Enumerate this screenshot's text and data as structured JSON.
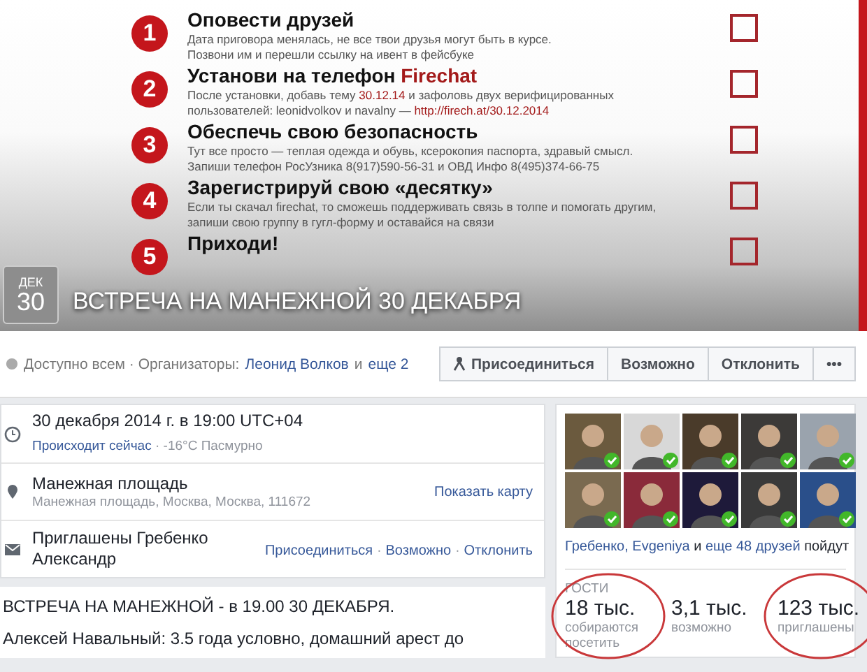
{
  "cover": {
    "checklist": [
      {
        "number": "1",
        "title": "Оповести друзей",
        "lines": [
          "Дата приговора менялась, не все твои друзья могут быть в курсе.",
          "Позвони им и перешли ссылку на ивент в фейсбуке"
        ],
        "checked": false
      },
      {
        "number": "2",
        "title": "Установи на телефон **Firechat**",
        "lines": [
          "После установки, добавь тему **30.12.14** и зафоловь двух верифицированных",
          "пользователей: leonidvolkov и navalny —  **http://firech.at/30.12.2014**"
        ],
        "checked": false
      },
      {
        "number": "3",
        "title": "Обеспечь свою безопасность",
        "lines": [
          "Тут все просто — теплая одежда и обувь, ксерокопия паспорта, здравый смысл.",
          "Запиши телефон РосУзника 8(917)590-56-31 и ОВД Инфо 8(495)374-66-75"
        ],
        "checked": false
      },
      {
        "number": "4",
        "title": "Зарегистрируй свою «десятку»",
        "lines": [
          "Если ты скачал firechat, то сможешь поддерживать связь в толпе и помогать другим,",
          "запиши свою группу в гугл-форму и оставайся на связи"
        ],
        "checked": false
      },
      {
        "number": "5",
        "title": "Приходи!",
        "checked": false
      }
    ],
    "date_badge": {
      "month": "ДЕК",
      "day": "30"
    },
    "title": "ВСТРЕЧА НА МАНЕЖНОЙ 30 ДЕКАБРЯ"
  },
  "info_bar": {
    "privacy": "Доступно всем · Организаторы:",
    "organizer": "Леонид Волков",
    "and": "и",
    "more": "еще 2",
    "buttons": [
      {
        "label": "Присоединиться",
        "kind": "join"
      },
      {
        "label": "Возможно",
        "kind": "plain"
      },
      {
        "label": "Отклонить",
        "kind": "plain"
      },
      {
        "label": "•••",
        "kind": "more"
      }
    ]
  },
  "details": [
    {
      "kind": "time",
      "title": "30 декабря 2014 г. в 19:00 UTC+04",
      "status": "Происходит сейчас",
      "sub": " · -16°C Пасмурно"
    },
    {
      "kind": "place",
      "title": "Манежная площадь",
      "sub": "Манежная площадь, Москва, Москва, 111672",
      "action": "Показать карту"
    },
    {
      "kind": "invite",
      "title": "Приглашены Гребенко Александр",
      "actions": [
        "Присоединиться",
        "Возможно",
        "Отклонить"
      ],
      "separator": "·"
    }
  ],
  "description": [
    "ВСТРЕЧА НА МАНЕЖНОЙ - в 19.00 30 ДЕКАБРЯ.",
    "Алексей Навальный: 3.5 года условно, домашний арест до"
  ],
  "friends": {
    "avatars": [
      {
        "going": true
      },
      {
        "going": true
      },
      {
        "going": true
      },
      {
        "going": true
      },
      {
        "going": true
      },
      {
        "going": true
      },
      {
        "going": true
      },
      {
        "going": true
      },
      {
        "going": true
      },
      {
        "going": true
      }
    ],
    "names": "Гребенко, Evgeniya",
    "and": "и",
    "more": "еще 48 друзей",
    "suffix": "пойдут"
  },
  "guests": {
    "heading": "ГОСТИ",
    "stats": [
      {
        "value": "18 тыс.",
        "label": "собираются посетить",
        "circled": true
      },
      {
        "value": "3,1 тыс.",
        "label": "возможно",
        "circled": false
      },
      {
        "value": "123 тыс.",
        "label": "приглашены",
        "circled": true
      }
    ]
  }
}
